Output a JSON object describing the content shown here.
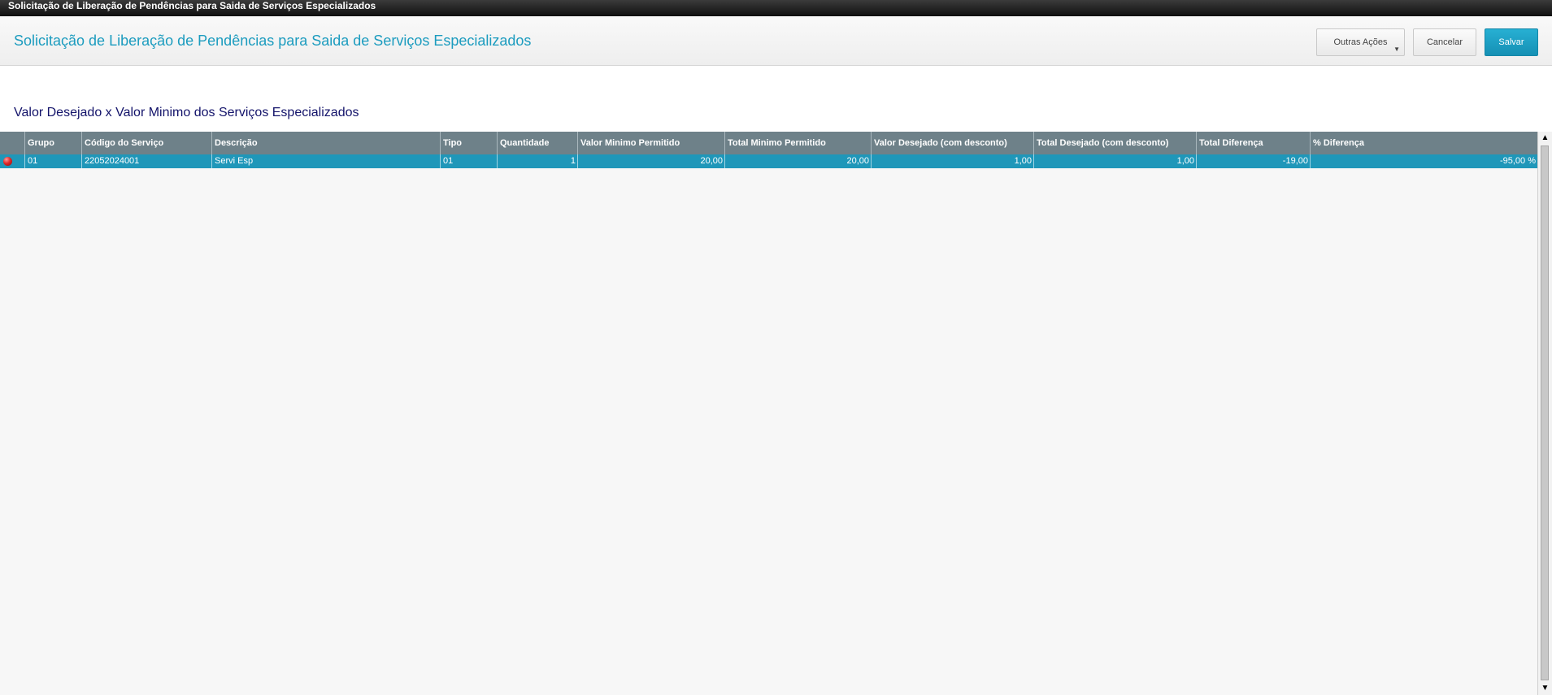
{
  "window": {
    "title": "Solicitação de Liberação de Pendências para Saida de Serviços Especializados"
  },
  "header": {
    "title": "Solicitação de Liberação de Pendências para Saida de Serviços Especializados",
    "buttons": {
      "outras_acoes": "Outras Ações",
      "cancelar": "Cancelar",
      "salvar": "Salvar"
    }
  },
  "section": {
    "title": "Valor Desejado x Valor Minimo dos Serviços Especializados"
  },
  "grid": {
    "columns": [
      "",
      "Grupo",
      "Código do Serviço",
      "Descrição",
      "Tipo",
      "Quantidade",
      "Valor Minimo Permitido",
      "Total Minimo Permitido",
      "Valor Desejado (com desconto)",
      "Total Desejado (com desconto)",
      "Total Diferença",
      "% Diferença"
    ],
    "rows": [
      {
        "status": "red-status-icon",
        "grupo": "01",
        "codigo": "22052024001",
        "descricao": "Servi Esp",
        "tipo": "01",
        "quantidade": "1",
        "valor_minimo": "20,00",
        "total_minimo": "20,00",
        "valor_desejado": "1,00",
        "total_desejado": "1,00",
        "total_diferenca": "-19,00",
        "perc_diferenca": "-95,00 %"
      }
    ]
  },
  "colors": {
    "accent": "#1c9cbf",
    "header_bg": "#6e8189",
    "selected_row": "#1f97b9",
    "section_title": "#13136a",
    "status_red": "#e02a2a"
  }
}
